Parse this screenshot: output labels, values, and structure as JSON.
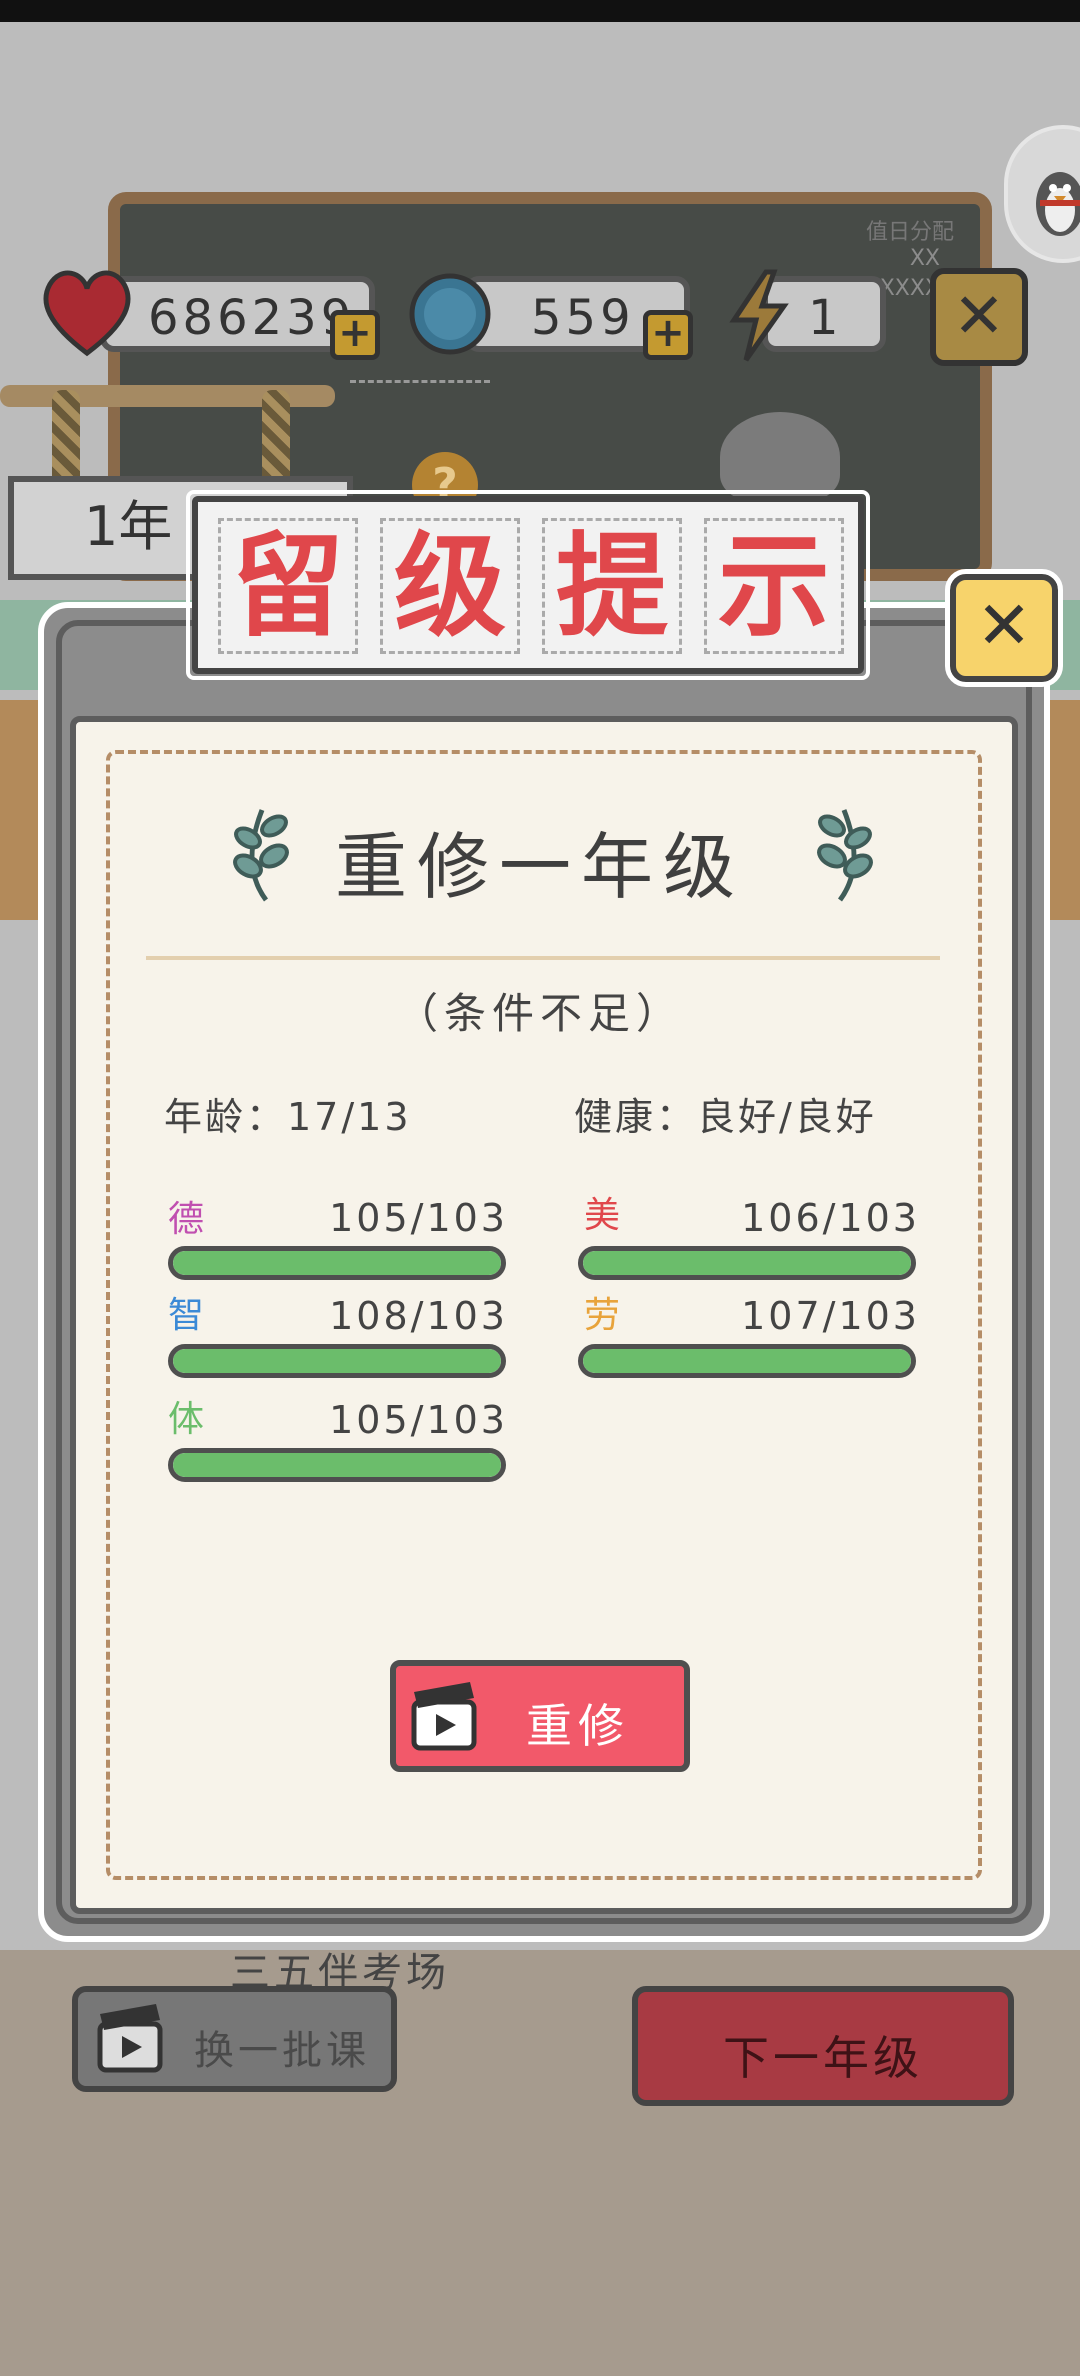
{
  "resources": {
    "hearts": "686239",
    "caps": "559",
    "energy": "1"
  },
  "scene": {
    "year_sign": "1年",
    "chalk_label": "值日分配",
    "chalk_lines": [
      "XX",
      "XXXX"
    ],
    "help": "?",
    "behind_text": "三五伴考场"
  },
  "modal": {
    "title_chars": [
      "留",
      "级",
      "提",
      "示"
    ],
    "heading": "重修一年级",
    "condition": "（条件不足）",
    "age": "年龄：17/13",
    "health": "健康：良好/良好",
    "stats": [
      {
        "label": "德",
        "value": "105/103",
        "color": "#c04fb0",
        "progress": 1.0
      },
      {
        "label": "智",
        "value": "108/103",
        "color": "#3b8ad6",
        "progress": 1.0
      },
      {
        "label": "体",
        "value": "105/103",
        "color": "#6bbd6b",
        "progress": 1.0
      },
      {
        "label": "美",
        "value": "106/103",
        "color": "#e0474b",
        "progress": 1.0
      },
      {
        "label": "劳",
        "value": "107/103",
        "color": "#e8a33b",
        "progress": 1.0
      }
    ],
    "retake_button": "重修",
    "close_symbol": "✕"
  },
  "bottom": {
    "swap_button": "换一批课",
    "next_button": "下一年级"
  }
}
